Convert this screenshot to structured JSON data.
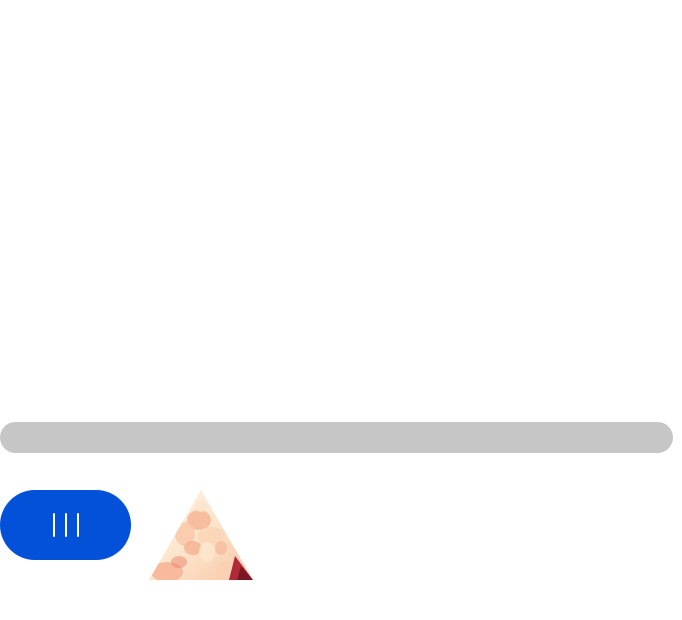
{
  "page": {
    "background": "#ffffff"
  },
  "scrollbar": {
    "track_color": "#c6c6c6"
  },
  "menu_button": {
    "icon": "menu-bars-icon",
    "color": "#0251d8",
    "glyph_color": "#ffffff"
  },
  "thumbnail": {
    "icon": "triangle-image-thumbnail",
    "palette": [
      "#fde5cc",
      "#f6b192",
      "#e9836c",
      "#b12a3a",
      "#7b1723"
    ]
  }
}
